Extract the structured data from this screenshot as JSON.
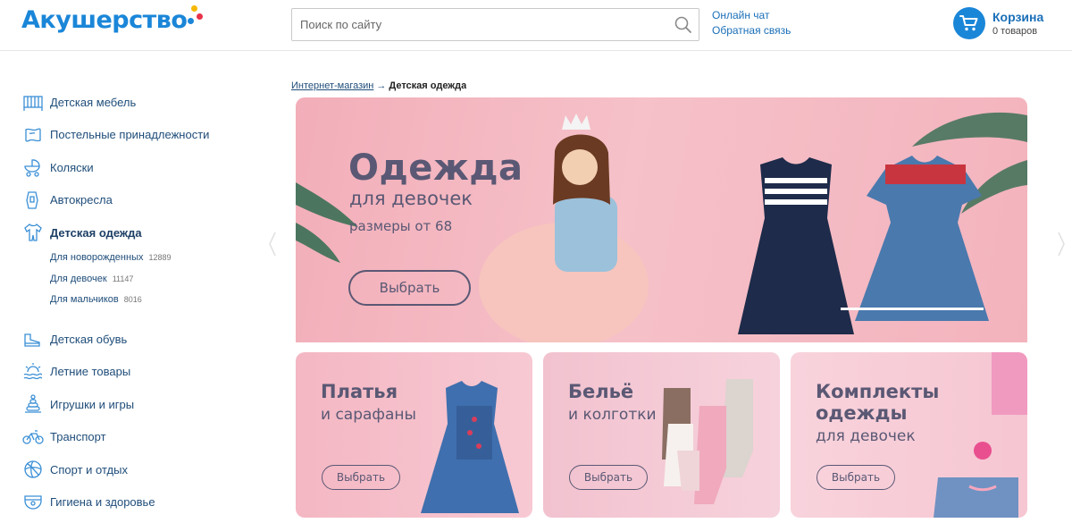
{
  "header": {
    "logo_text": "Акушерство",
    "search_placeholder": "Поиск по сайту",
    "links": [
      "Онлайн чат",
      "Обратная связь"
    ],
    "cart": {
      "title": "Корзина",
      "count": "0 товаров"
    }
  },
  "sidebar": {
    "categories": [
      {
        "label": "Детская мебель",
        "icon": "crib-icon"
      },
      {
        "label": "Постельные принадлежности",
        "icon": "bedding-icon"
      },
      {
        "label": "Коляски",
        "icon": "stroller-icon"
      },
      {
        "label": "Автокресла",
        "icon": "car-seat-icon"
      },
      {
        "label": "Детская одежда",
        "icon": "baby-clothes-icon"
      },
      {
        "label": "Детская обувь",
        "icon": "shoe-icon"
      },
      {
        "label": "Летние товары",
        "icon": "summer-icon"
      },
      {
        "label": "Игрушки и игры",
        "icon": "pyramid-toy-icon"
      },
      {
        "label": "Транспорт",
        "icon": "bicycle-icon"
      },
      {
        "label": "Спорт и отдых",
        "icon": "ball-icon"
      },
      {
        "label": "Гигиена и здоровье",
        "icon": "diaper-icon"
      }
    ],
    "subcategories": [
      {
        "label": "Для новорожденных",
        "count": "12889"
      },
      {
        "label": "Для девочек",
        "count": "11147"
      },
      {
        "label": "Для мальчиков",
        "count": "8016"
      }
    ]
  },
  "breadcrumb": {
    "root": "Интернет-магазин",
    "separator": "→",
    "current": "Детская одежда"
  },
  "hero": {
    "title": "Одежда",
    "subtitle": "для девочек",
    "sizes": "размеры от 68",
    "button": "Выбрать"
  },
  "cards": [
    {
      "title": "Платья",
      "subtitle": "и сарафаны",
      "button": "Выбрать"
    },
    {
      "title": "Бельё",
      "subtitle": "и колготки",
      "button": "Выбрать"
    },
    {
      "title": "Комплекты одежды",
      "subtitle": "для девочек",
      "button": "Выбрать"
    }
  ],
  "colors": {
    "brand": "#1a86d8",
    "link": "#1f4d7a",
    "banner_pink": "#f5b8c2",
    "banner_text": "#5a5874"
  }
}
